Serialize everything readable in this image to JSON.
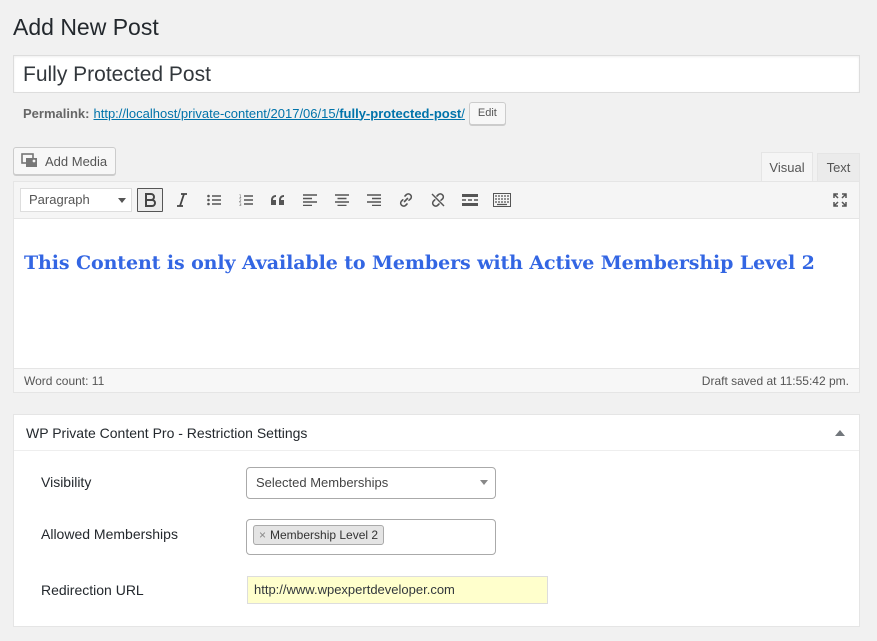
{
  "page": {
    "title": "Add New Post"
  },
  "post": {
    "title": "Fully Protected Post",
    "permalink_label": "Permalink:",
    "permalink_base": "http://localhost/private-content/2017/06/15/",
    "permalink_slug": "fully-protected-post",
    "permalink_trailing": "/",
    "edit_label": "Edit"
  },
  "editor": {
    "add_media_label": "Add Media",
    "tabs": [
      {
        "label": "Visual",
        "active": true
      },
      {
        "label": "Text",
        "active": false
      }
    ],
    "format_select": "Paragraph",
    "toolbar_icons": [
      "bold-icon",
      "italic-icon",
      "bullet-list-icon",
      "numbered-list-icon",
      "blockquote-icon",
      "align-left-icon",
      "align-center-icon",
      "align-right-icon",
      "link-icon",
      "unlink-icon",
      "read-more-icon",
      "toolbar-toggle-icon",
      "fullscreen-icon"
    ],
    "content_heading": "This Content is only Available to Members with Active Membership Level 2",
    "content_color": "#3366e3",
    "word_count": "Word count: 11",
    "draft_status": "Draft saved at 11:55:42 pm."
  },
  "restriction": {
    "title": "WP Private Content Pro - Restriction Settings",
    "visibility_label": "Visibility",
    "visibility_value": "Selected Memberships",
    "allowed_label": "Allowed Memberships",
    "allowed_remove": "×",
    "allowed_value": "Membership Level 2",
    "redirect_label": "Redirection URL",
    "redirect_value": "http://www.wpexpertdeveloper.com"
  }
}
